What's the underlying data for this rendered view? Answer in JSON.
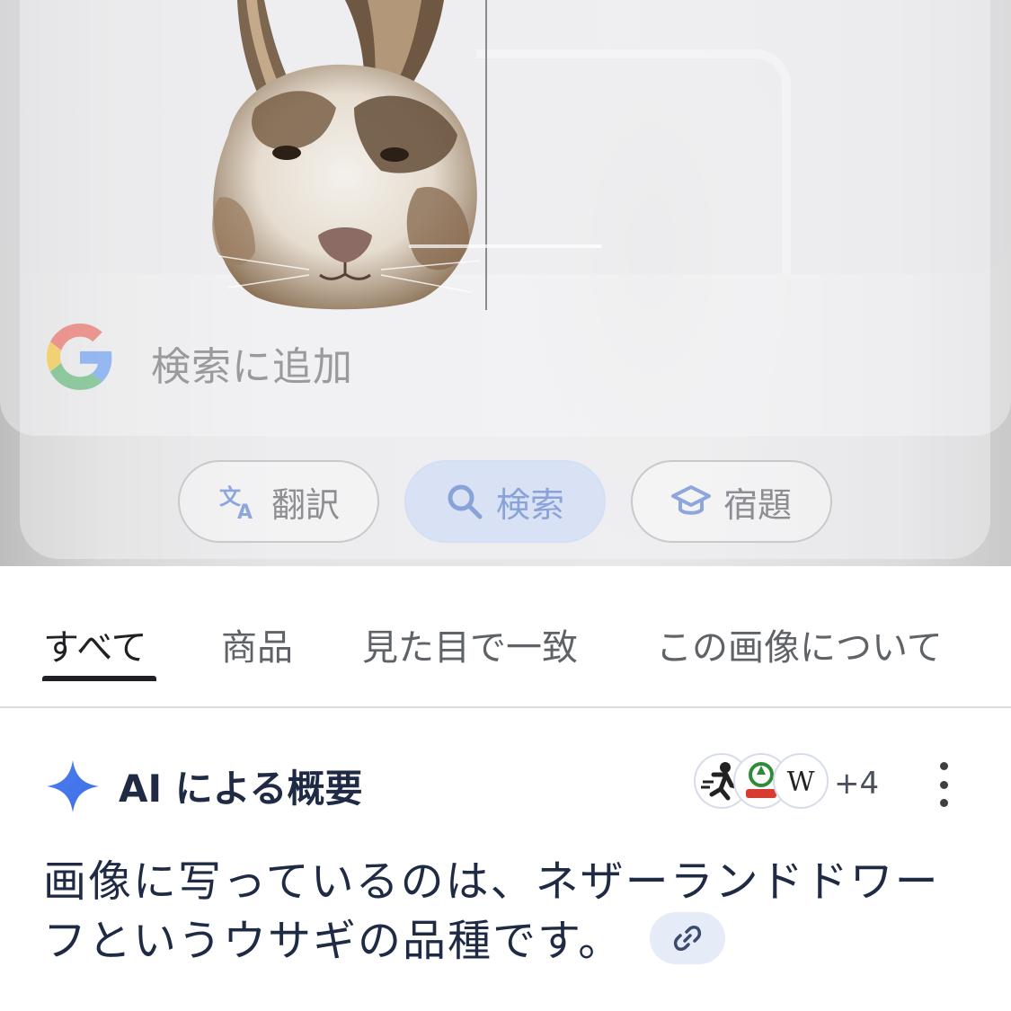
{
  "search": {
    "placeholder": "検索に追加"
  },
  "actions": [
    {
      "label": "翻訳",
      "icon": "translate-icon"
    },
    {
      "label": "検索",
      "icon": "search-icon",
      "active": true
    },
    {
      "label": "宿題",
      "icon": "graduation-cap-icon"
    }
  ],
  "tabs": [
    {
      "label": "すべて",
      "active": true
    },
    {
      "label": "商品"
    },
    {
      "label": "見た目で一致"
    },
    {
      "label": "この画像について"
    }
  ],
  "ai_overview": {
    "title": "AI による概要",
    "source_count": "+4",
    "source_icons": [
      "runner-logo-icon",
      "green-logo-icon",
      "wikipedia-icon"
    ],
    "text": "画像に写っているのは、ネザーランドドワーフというウサギの品種です。"
  },
  "colors": {
    "accent": "#4a7ef0",
    "active_chip_bg": "#d2def6",
    "text_primary": "#1f2a44"
  }
}
